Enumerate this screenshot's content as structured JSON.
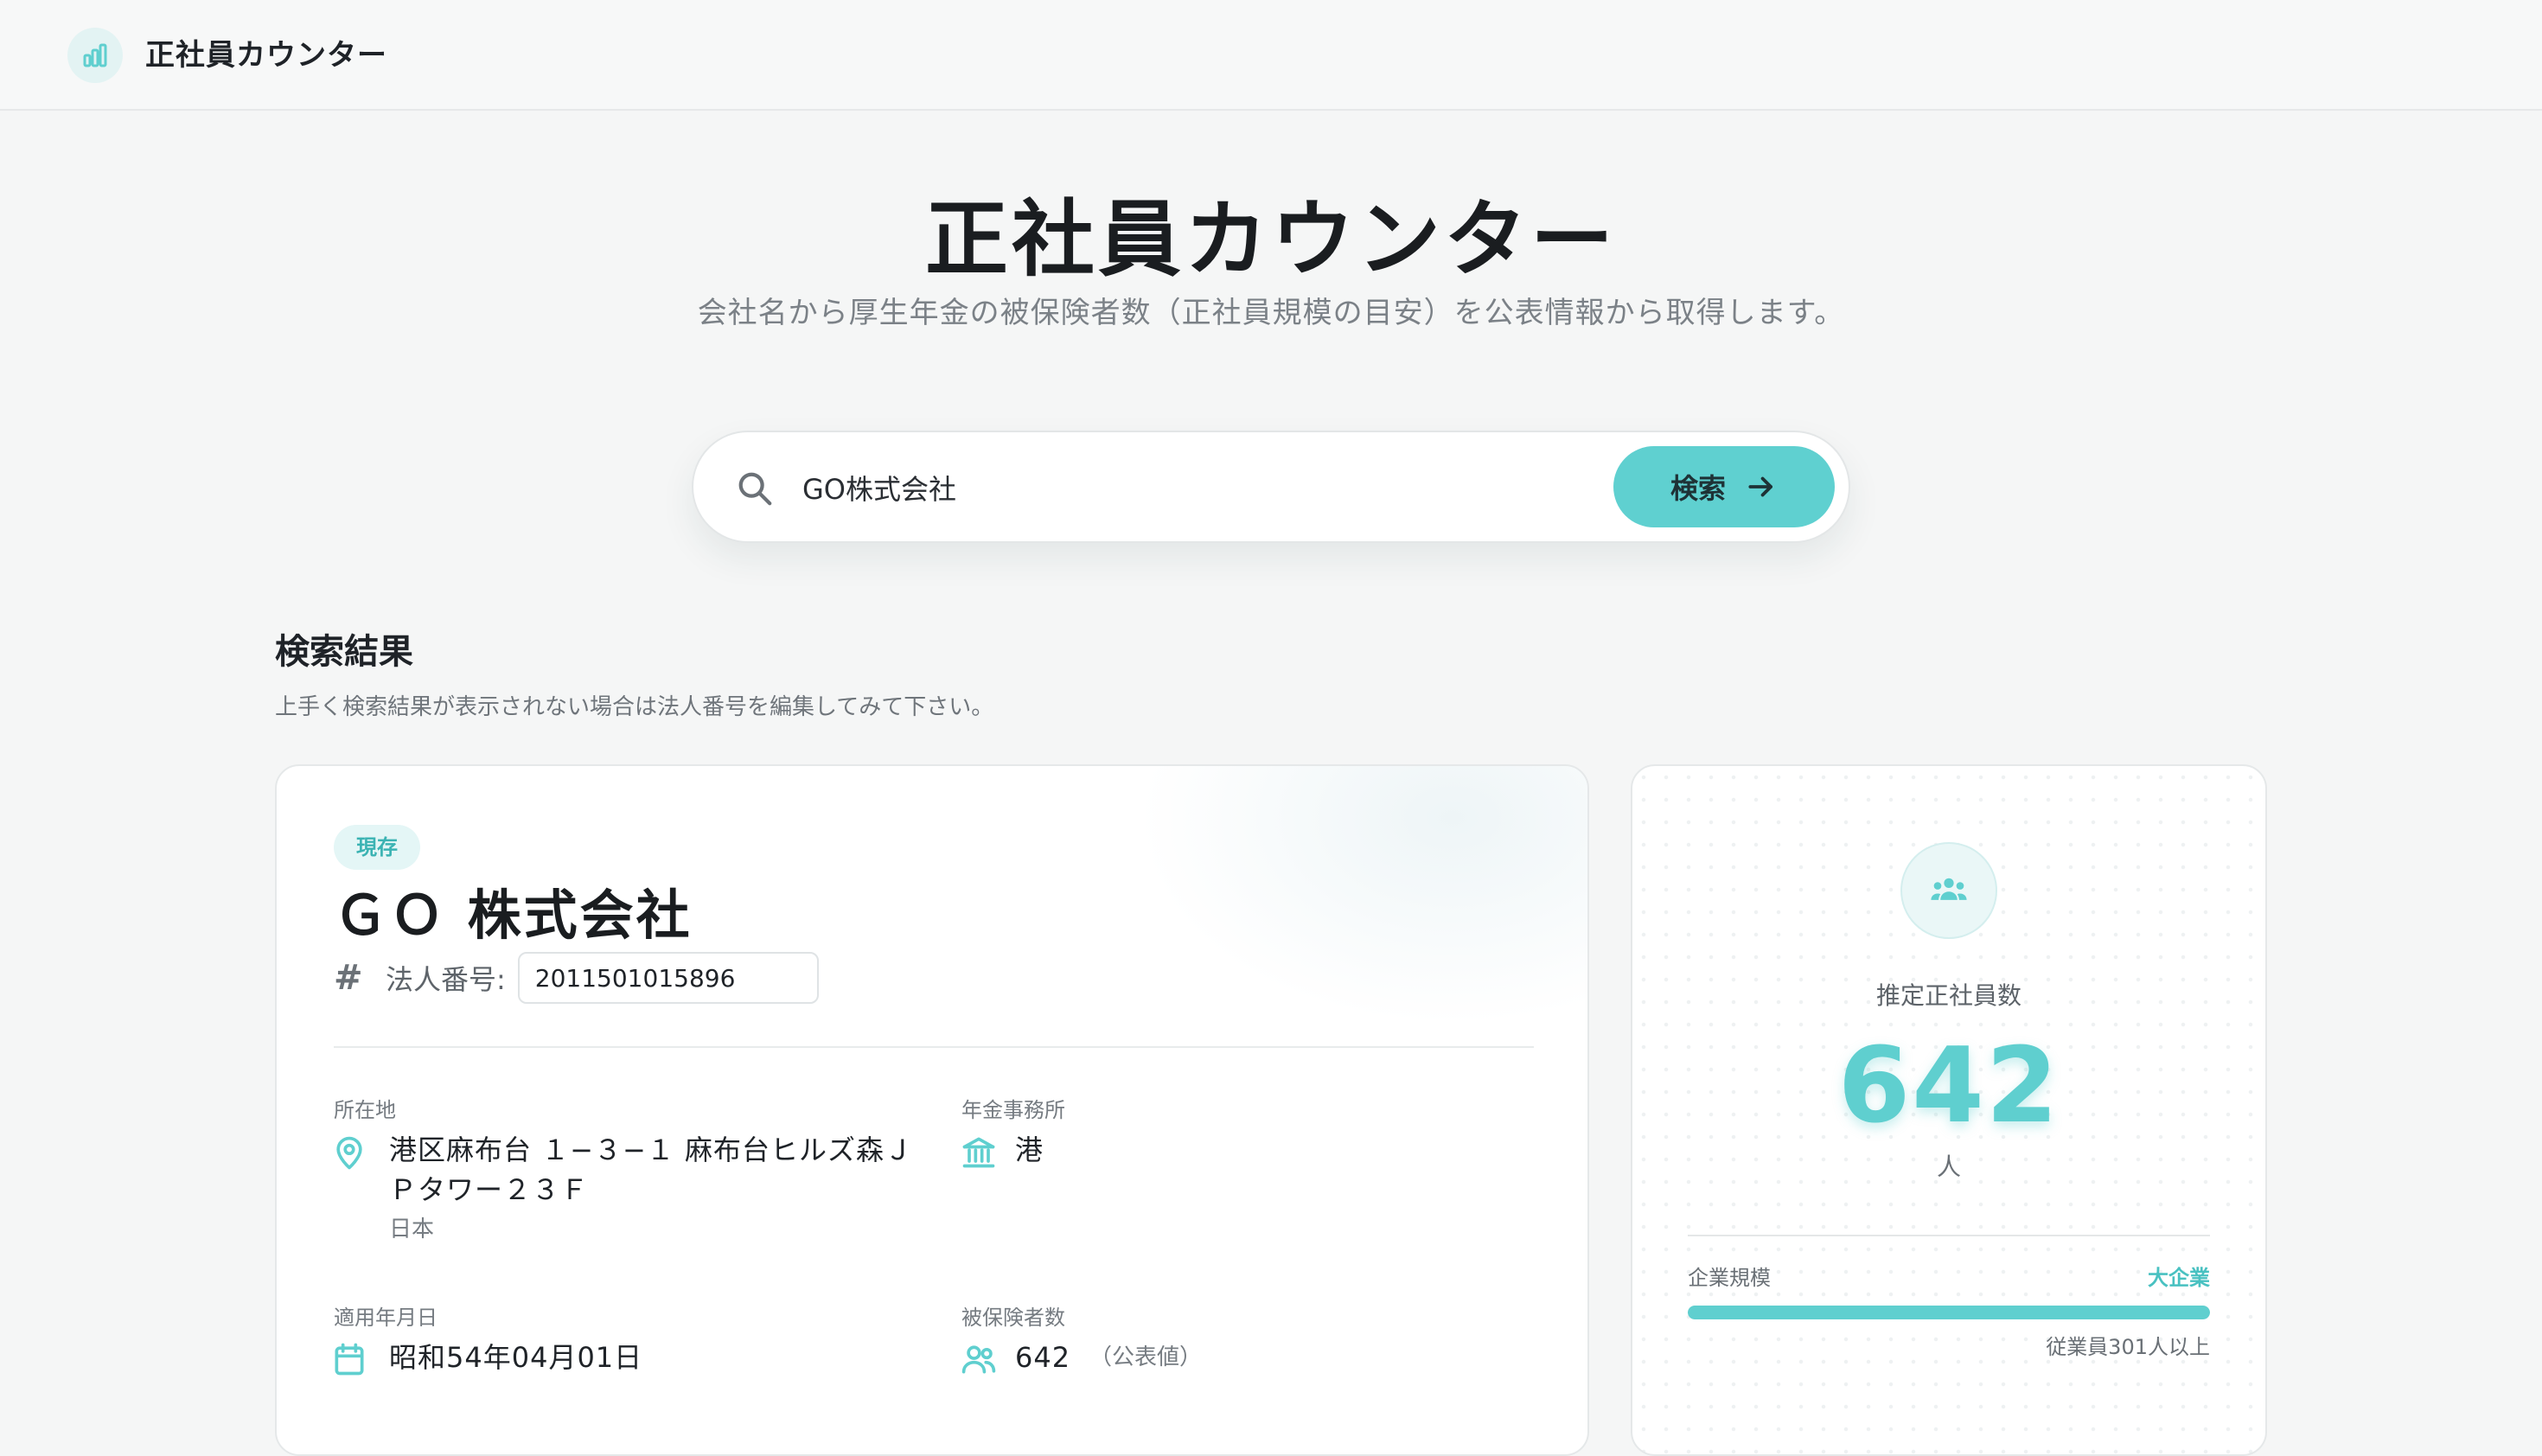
{
  "header": {
    "brand_name": "正社員カウンター",
    "logo_icon": "bar-chart-icon"
  },
  "hero": {
    "title": "正社員カウンター",
    "subtitle": "会社名から厚生年金の被保険者数（正社員規模の目安）を公表情報から取得します。"
  },
  "search": {
    "value": "GO株式会社",
    "button_label": "検索"
  },
  "results": {
    "title": "検索結果",
    "hint": "上手く検索結果が表示されない場合は法人番号を編集してみて下さい。"
  },
  "company": {
    "status": "現存",
    "name": "ＧＯ 株式会社",
    "corp_number_label": "法人番号:",
    "corp_number": "2011501015896",
    "address_label": "所在地",
    "address_line1": "港区麻布台 １−３−１ 麻布台ヒルズ森Ｊ",
    "address_line2": "Ｐタワー２３Ｆ",
    "country": "日本",
    "pension_office_label": "年金事務所",
    "pension_office": "港",
    "applied_date_label": "適用年月日",
    "applied_date": "昭和54年04月01日",
    "insured_label": "被保険者数",
    "insured_count": "642",
    "insured_note": "（公表値）"
  },
  "count": {
    "label": "推定正社員数",
    "value": "642",
    "unit": "人",
    "scale_label": "企業規模",
    "scale_value": "大企業",
    "scale_fill": 1.0,
    "scale_note": "従業員301人以上"
  },
  "colors": {
    "accent": "#5fcfcf",
    "accent_dark": "#49c1c1",
    "badge_bg": "#e4f6f6"
  }
}
